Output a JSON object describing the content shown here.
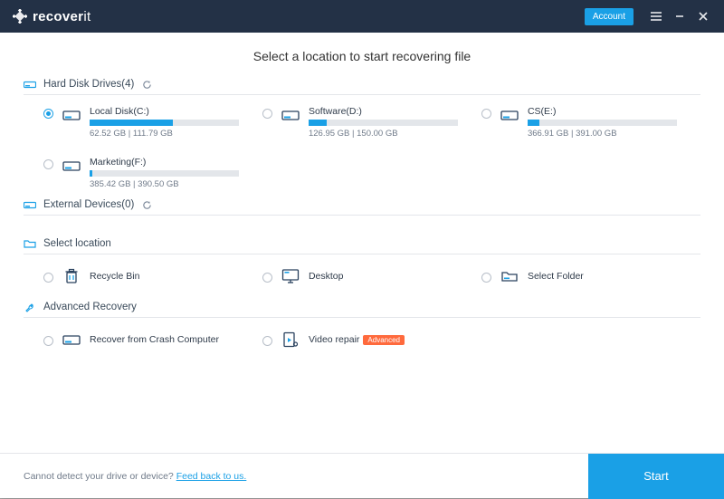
{
  "titlebar": {
    "brand_bold": "recover",
    "brand_light": "it",
    "account_label": "Account"
  },
  "page_title": "Select a location to start recovering file",
  "sections": {
    "hdd": {
      "label": "Hard Disk Drives(4)",
      "drives": [
        {
          "name": "Local Disk(C:)",
          "used": "62.52  GB",
          "total": "111.79  GB",
          "pct": 56,
          "selected": true
        },
        {
          "name": "Software(D:)",
          "used": "126.95  GB",
          "total": "150.00  GB",
          "pct": 12,
          "selected": false
        },
        {
          "name": "CS(E:)",
          "used": "366.91  GB",
          "total": "391.00  GB",
          "pct": 8,
          "selected": false
        },
        {
          "name": "Marketing(F:)",
          "used": "385.42  GB",
          "total": "390.50  GB",
          "pct": 2,
          "selected": false
        }
      ]
    },
    "ext": {
      "label": "External Devices(0)"
    },
    "select_location": {
      "label": "Select location",
      "items": [
        {
          "name": "Recycle Bin",
          "icon": "trash"
        },
        {
          "name": "Desktop",
          "icon": "monitor"
        },
        {
          "name": "Select Folder",
          "icon": "folder"
        }
      ]
    },
    "advanced": {
      "label": "Advanced Recovery",
      "items": [
        {
          "name": "Recover from Crash Computer",
          "icon": "drive",
          "badge": null
        },
        {
          "name": "Video repair",
          "icon": "video",
          "badge": "Advanced"
        }
      ]
    }
  },
  "footer": {
    "prefix": "Cannot detect your drive or device? ",
    "link": "Feed back to us.",
    "start_label": "Start"
  }
}
